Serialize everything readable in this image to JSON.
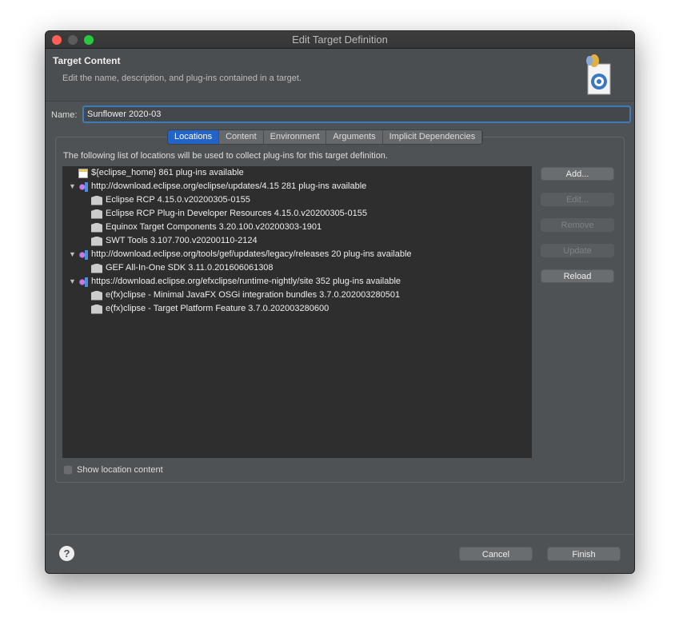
{
  "window": {
    "title": "Edit Target Definition"
  },
  "header": {
    "title": "Target Content",
    "description": "Edit the name, description, and plug-ins contained in a target."
  },
  "name": {
    "label": "Name:",
    "value": "Sunflower 2020-03"
  },
  "tabs": [
    {
      "label": "Locations",
      "active": true
    },
    {
      "label": "Content"
    },
    {
      "label": "Environment"
    },
    {
      "label": "Arguments"
    },
    {
      "label": "Implicit Dependencies"
    }
  ],
  "locations": {
    "info": "The following list of locations will be used to collect plug-ins for this target definition.",
    "rows": [
      {
        "label": "${eclipse_home} 861 plug-ins available",
        "icon": "install-icon",
        "level": 0,
        "twisty": false
      },
      {
        "label": "http://download.eclipse.org/eclipse/updates/4.15 281 plug-ins available",
        "icon": "site-icon",
        "level": 0,
        "twisty": true
      },
      {
        "label": "Eclipse RCP 4.15.0.v20200305-0155",
        "icon": "feature-icon",
        "level": 1
      },
      {
        "label": "Eclipse RCP Plug-in Developer Resources 4.15.0.v20200305-0155",
        "icon": "feature-icon",
        "level": 1
      },
      {
        "label": "Equinox Target Components 3.20.100.v20200303-1901",
        "icon": "feature-icon",
        "level": 1
      },
      {
        "label": "SWT Tools 3.107.700.v20200110-2124",
        "icon": "feature-icon",
        "level": 1
      },
      {
        "label": "http://download.eclipse.org/tools/gef/updates/legacy/releases 20 plug-ins available",
        "icon": "site-icon",
        "level": 0,
        "twisty": true
      },
      {
        "label": "GEF All-In-One SDK 3.11.0.201606061308",
        "icon": "feature-icon",
        "level": 1
      },
      {
        "label": "https://download.eclipse.org/efxclipse/runtime-nightly/site 352 plug-ins available",
        "icon": "site-icon",
        "level": 0,
        "twisty": true
      },
      {
        "label": "e(fx)clipse - Minimal JavaFX OSGi integration bundles 3.7.0.202003280501",
        "icon": "feature-icon",
        "level": 1
      },
      {
        "label": "e(fx)clipse - Target Platform Feature 3.7.0.202003280600",
        "icon": "feature-icon",
        "level": 1
      }
    ],
    "buttons": [
      {
        "label": "Add...",
        "enabled": true
      },
      {
        "label": "Edit...",
        "enabled": false
      },
      {
        "label": "Remove",
        "enabled": false
      },
      {
        "label": "Update",
        "enabled": false
      },
      {
        "label": "Reload",
        "enabled": true
      }
    ],
    "show_content_label": "Show location content"
  },
  "footer": {
    "help": "?",
    "cancel": "Cancel",
    "finish": "Finish"
  }
}
